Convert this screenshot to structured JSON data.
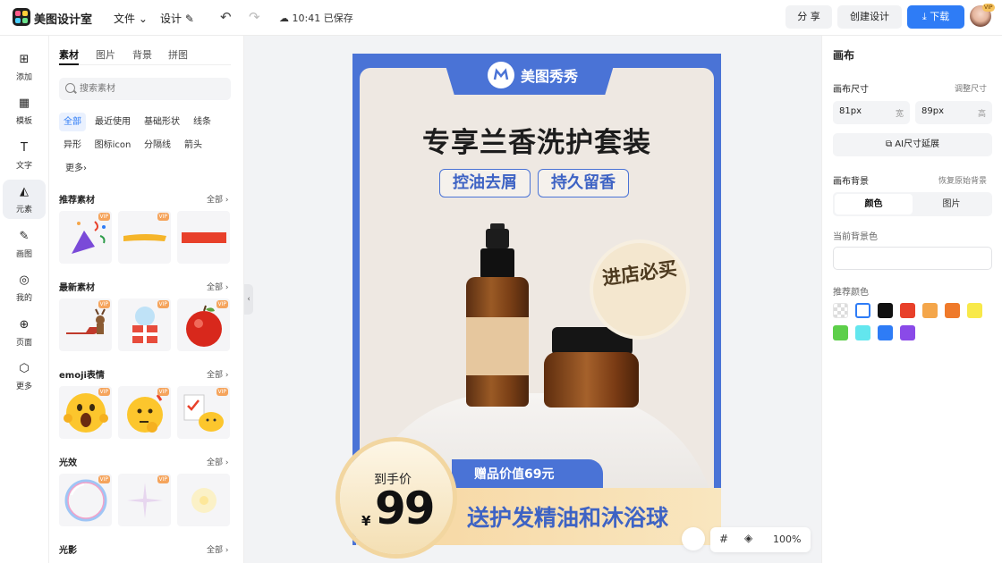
{
  "topbar": {
    "app_name": "美图设计室",
    "menu_file": "文件",
    "menu_design": "设计",
    "saved_status": "10:41 已保存",
    "share": "分 享",
    "create": "创建设计",
    "download": "下载",
    "avatar_badge": "VIP"
  },
  "leftnav": {
    "items": [
      {
        "label": "添加",
        "icon": "plus-square-icon"
      },
      {
        "label": "模板",
        "icon": "template-icon"
      },
      {
        "label": "文字",
        "icon": "text-icon"
      },
      {
        "label": "元素",
        "icon": "shapes-icon"
      },
      {
        "label": "画图",
        "icon": "draw-icon"
      },
      {
        "label": "我的",
        "icon": "user-icon"
      },
      {
        "label": "页面",
        "icon": "page-add-icon"
      },
      {
        "label": "更多",
        "icon": "cube-icon"
      }
    ],
    "active": "元素"
  },
  "panel": {
    "tabs": [
      "素材",
      "图片",
      "背景",
      "拼图"
    ],
    "search_placeholder": "搜索素材",
    "chips": [
      "全部",
      "最近使用",
      "基础形状",
      "线条",
      "异形",
      "图标icon",
      "分隔线",
      "箭头",
      "更多"
    ],
    "all_label": "全部",
    "vip": "VIP",
    "sections": [
      {
        "title": "推荐素材"
      },
      {
        "title": "最新素材"
      },
      {
        "title": "emoji表情"
      },
      {
        "title": "光效"
      },
      {
        "title": "光影"
      }
    ]
  },
  "poster": {
    "brand": "美图秀秀",
    "title": "专享兰香洗护套装",
    "tag1": "控油去屑",
    "tag2": "持久留香",
    "badge": "进店必买",
    "gift": "赠品价值69元",
    "bottom_text": "送护发精油和沐浴球",
    "price_label": "到手价",
    "currency": "¥",
    "price": "99",
    "accent": "#4a73d6"
  },
  "zoom": {
    "level": "100%"
  },
  "rpanel": {
    "title": "画布",
    "size_label": "画布尺寸",
    "size_link": "调整尺寸",
    "width_value": "81px",
    "width_unit": "宽",
    "height_value": "89px",
    "height_unit": "高",
    "ai_button": "AI尺寸延展",
    "bg_label": "画布背景",
    "bg_reset": "恢复原始背景",
    "seg_color": "颜色",
    "seg_image": "图片",
    "current_bg": "当前背景色",
    "recommend": "推荐颜色",
    "swatches": [
      "transparent",
      "#ffffff",
      "#111111",
      "#e8402a",
      "#f4a64a",
      "#ef7a2b",
      "#f8e94a",
      "#5dcf4a",
      "#63e6ee",
      "#2e7cf6",
      "#8a4ae8"
    ]
  }
}
